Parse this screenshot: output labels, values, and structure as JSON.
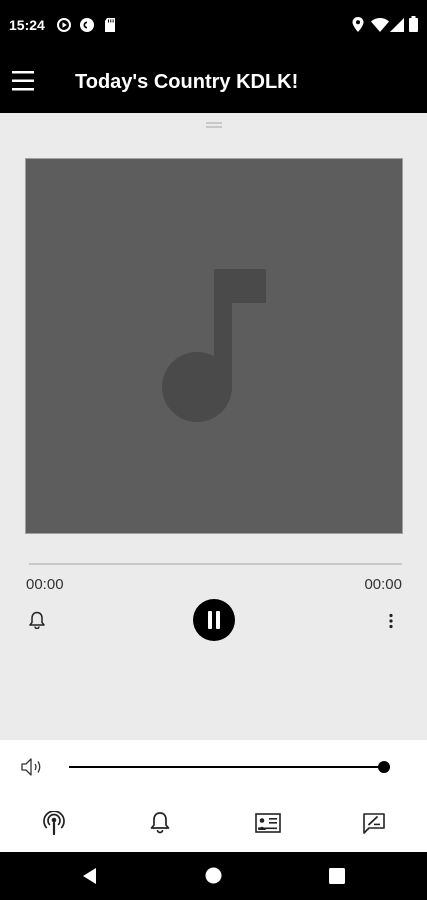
{
  "status_bar": {
    "time": "15:24",
    "left_icons": [
      "play-circle-icon",
      "pocket-casts-icon",
      "sd-card-icon"
    ],
    "right_icons": [
      "location-icon",
      "wifi-icon",
      "signal-icon",
      "battery-icon"
    ]
  },
  "app_bar": {
    "title": "Today's Country KDLK!",
    "menu_icon": "hamburger-menu-icon"
  },
  "player": {
    "artwork_icon": "music-note-icon",
    "elapsed": "00:00",
    "duration": "00:00",
    "progress": 0,
    "state": "playing",
    "volume": 0.98
  },
  "tabs": [
    {
      "icon": "podcast-icon"
    },
    {
      "icon": "alarm-bell-icon"
    },
    {
      "icon": "news-icon"
    },
    {
      "icon": "message-icon"
    }
  ],
  "colors": {
    "bar_background": "#000000",
    "artwork_background": "#5d5d5d",
    "content_background": "#ebebeb"
  }
}
